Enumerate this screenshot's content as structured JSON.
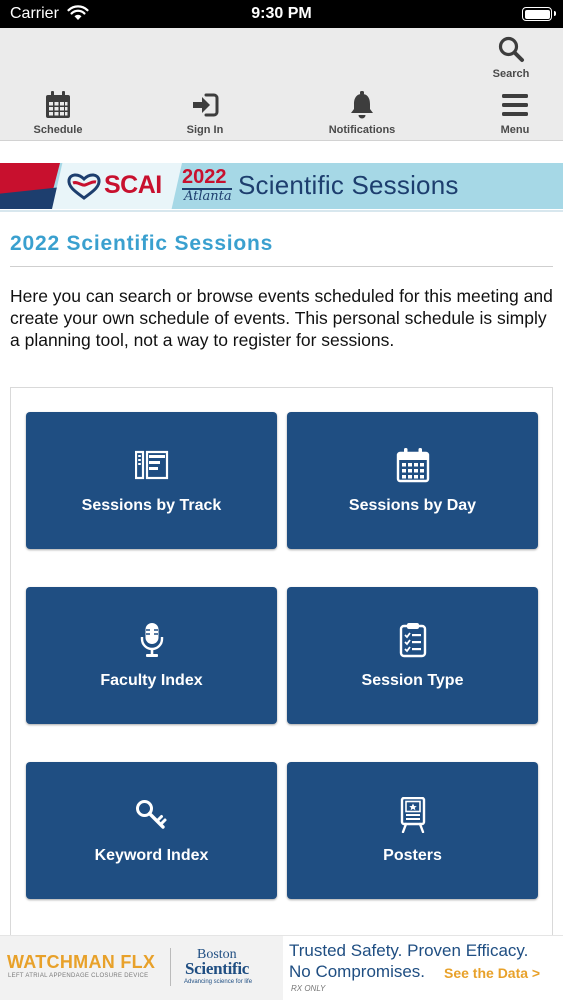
{
  "status_bar": {
    "carrier": "Carrier",
    "time": "9:30 PM"
  },
  "toolbar": {
    "search_label": "Search",
    "schedule_label": "Schedule",
    "sign_in_label": "Sign In",
    "notifications_label": "Notifications",
    "menu_label": "Menu"
  },
  "banner": {
    "org": "SCAI",
    "year": "2022",
    "city": "Atlanta",
    "event": "Scientific Sessions"
  },
  "page": {
    "title": "2022 Scientific Sessions",
    "intro": "Here you can search or browse events scheduled for this meeting and create your own schedule of events. This personal schedule is simply a planning tool, not a way to register for sessions."
  },
  "tiles": [
    {
      "label": "Sessions by Track",
      "icon": "track-icon"
    },
    {
      "label": "Sessions by Day",
      "icon": "calendar-icon"
    },
    {
      "label": "Faculty Index",
      "icon": "microphone-icon"
    },
    {
      "label": "Session Type",
      "icon": "clipboard-icon"
    },
    {
      "label": "Keyword Index",
      "icon": "key-icon"
    },
    {
      "label": "Posters",
      "icon": "poster-board-icon"
    }
  ],
  "ad": {
    "brand": "WATCHMAN FLX",
    "brand_tagline": "LEFT ATRIAL APPENDAGE CLOSURE DEVICE",
    "company_line1": "Boston",
    "company_line2": "Scientific",
    "company_tagline": "Advancing science for life",
    "headline1": "Trusted Safety. Proven Efficacy.",
    "headline2": "No Compromises.",
    "cta": "See the Data >",
    "rx": "RX ONLY"
  },
  "colors": {
    "tile_blue": "#1f4e82",
    "title_blue": "#3aa0cf",
    "banner_bg": "#a6d8e6",
    "scai_red": "#c8102e",
    "ad_gold": "#e8a12a"
  }
}
